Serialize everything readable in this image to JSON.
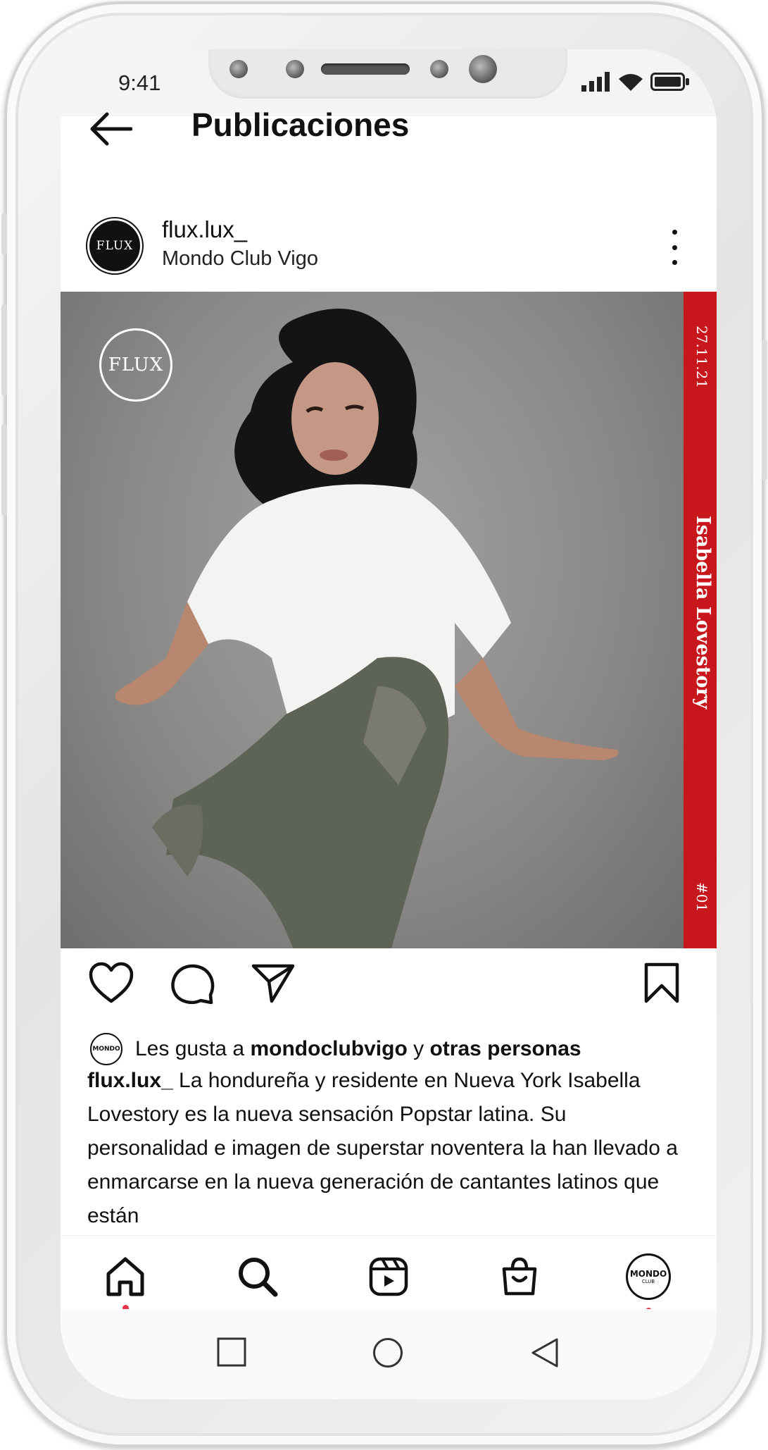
{
  "status_bar": {
    "time": "9:41"
  },
  "header": {
    "title": "Publicaciones"
  },
  "post": {
    "avatar_text": "FLUX",
    "username": "flux.lux_",
    "location": "Mondo Club Vigo",
    "image": {
      "logo_text": "FLUX",
      "strip_date": "27.11.21",
      "strip_name": "Isabella Lovestory",
      "strip_number": "#01",
      "strip_color": "#c8161d"
    },
    "likes": {
      "avatar_text": "MONDO",
      "prefix": "Les gusta a",
      "user": "mondoclubvigo",
      "joiner": "y",
      "others": "otras personas"
    },
    "caption": {
      "username": "flux.lux_",
      "text": "La hondureña y residente en Nueva York Isabella Lovestory es la nueva sensación Popstar latina. Su personalidad e imagen de superstar noventera la han llevado a enmarcarse en la nueva generación de cantantes latinos que están"
    }
  },
  "bottom_nav": {
    "items": [
      "home-icon",
      "search-icon",
      "reels-icon",
      "shop-icon",
      "profile-avatar"
    ],
    "profile_text": "MONDO",
    "profile_sub": "CLUB",
    "dot_color": "#e8344a"
  }
}
